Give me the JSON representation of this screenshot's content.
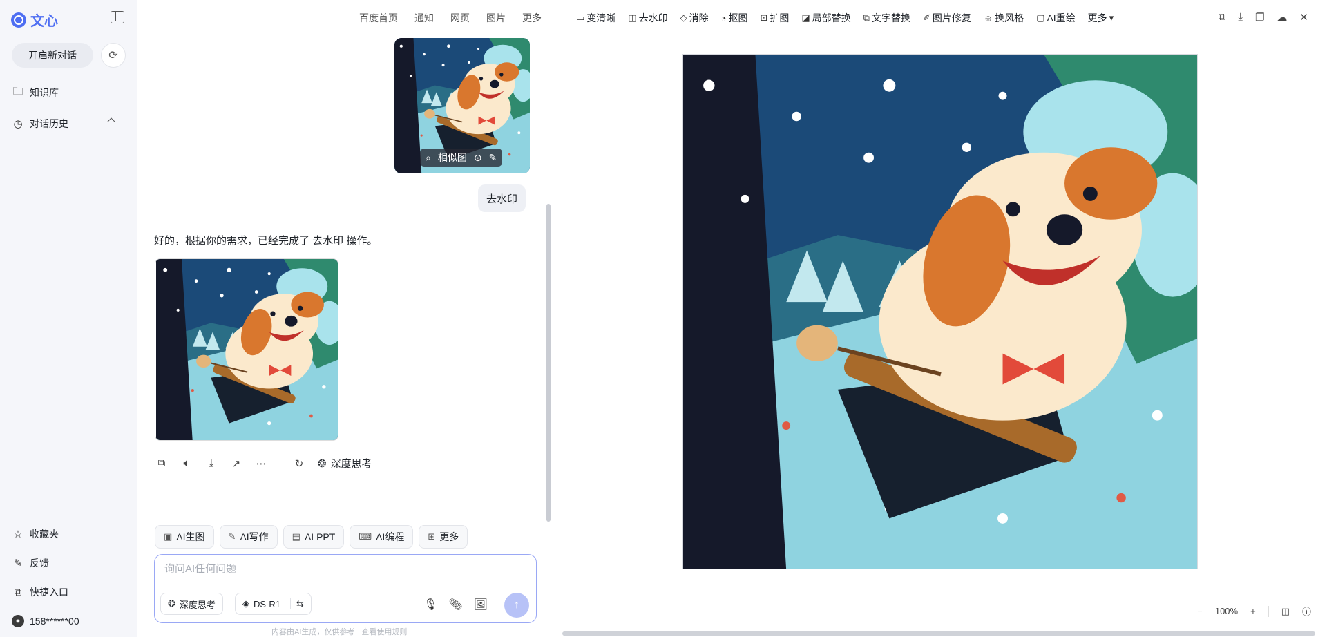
{
  "sidebar": {
    "brand": "文心",
    "new_chat": "开启新对话",
    "items": {
      "knowledge": "知识库",
      "history": "对话历史",
      "favorites": "收藏夹",
      "feedback": "反馈",
      "quick_entry": "快捷入口",
      "user": "158******00"
    }
  },
  "topnav": [
    "百度首页",
    "通知",
    "网页",
    "图片",
    "更多"
  ],
  "chat": {
    "similar_label": "相似图",
    "user_message": "去水印",
    "assistant_message": "好的，根据你的需求，已经完成了 去水印 操作。",
    "deep_think_action": "深度思考",
    "quick_actions": [
      "AI生图",
      "AI写作",
      "AI PPT",
      "AI编程",
      "更多"
    ],
    "composer": {
      "placeholder": "询问AI任何问题",
      "deep_think": "深度思考",
      "model": "DS-R1"
    },
    "disclaimer": [
      "内容由AI生成，仅供参考",
      "查看使用规则"
    ]
  },
  "editor": {
    "tools": [
      "变清晰",
      "去水印",
      "消除",
      "抠图",
      "扩图",
      "局部替换",
      "文字替换",
      "图片修复",
      "换风格",
      "AI重绘",
      "更多"
    ],
    "zoom": "100%"
  },
  "colors": {
    "accent": "#4e6ef2",
    "sky": "#1f4e7a",
    "snow": "#8fd3e0",
    "dog_orange": "#d9772e",
    "dog_cream": "#fbe9cc"
  },
  "icons": {
    "copy": "copy-icon",
    "audio": "speaker-icon",
    "download": "download-icon",
    "share": "share-icon",
    "more": "more-icon",
    "regen": "refresh-icon"
  }
}
